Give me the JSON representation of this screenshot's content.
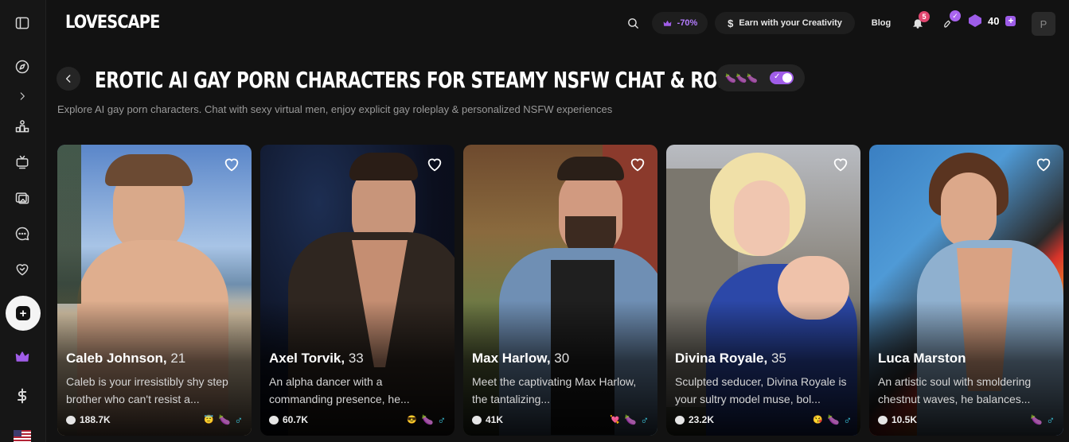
{
  "header": {
    "logo": "LOVESCAPE",
    "discount": "-70%",
    "earn_label": "Earn with your Creativity",
    "blog_label": "Blog",
    "notifications_count": "5",
    "coins": "40",
    "avatar_initial": "P"
  },
  "page": {
    "title": "EROTIC AI GAY PORN CHARACTERS FOR STEAMY NSFW CHAT & ROLEPLAY",
    "subtitle": "Explore AI gay porn characters. Chat with sexy virtual men, enjoy explicit gay roleplay & personalized NSFW experiences",
    "toggle_emojis": "🍆🍆🍆",
    "toggle_on": true
  },
  "icons": {
    "sidebar": [
      "sidebar-toggle-icon",
      "compass-icon",
      "chevron-right-icon",
      "leaderboard-icon",
      "tv-icon",
      "gallery-icon",
      "chat-icon",
      "heart-handshake-icon",
      "create-icon",
      "crown-icon",
      "dollar-icon",
      "us-flag-icon"
    ]
  },
  "colors": {
    "accent": "#a05de8",
    "background": "#121212",
    "male_symbol": "#3fd0e8"
  },
  "cards": [
    {
      "name": "Caleb Johnson",
      "age": "21",
      "description": "Caleb is your irresistibly shy step brother who can't resist a...",
      "count": "188.7K",
      "tag_emoji": "😇",
      "sex": "♂"
    },
    {
      "name": "Axel Torvik",
      "age": "33",
      "description": "An alpha dancer with a commanding presence, he...",
      "count": "60.7K",
      "tag_emoji": "😎",
      "sex": "♂"
    },
    {
      "name": "Max Harlow",
      "age": "30",
      "description": "Meet the captivating Max Harlow, the tantalizing...",
      "count": "41K",
      "tag_emoji": "💘",
      "sex": "♂"
    },
    {
      "name": "Divina Royale",
      "age": "35",
      "description": "Sculpted seducer, Divina Royale is your sultry model muse, bol...",
      "count": "23.2K",
      "tag_emoji": "😘",
      "sex": "♂"
    },
    {
      "name": "Luca Marston",
      "age": "",
      "description": "An artistic soul with smoldering chestnut waves, he balances...",
      "count": "10.5K",
      "tag_emoji": "",
      "sex": "♂"
    }
  ]
}
